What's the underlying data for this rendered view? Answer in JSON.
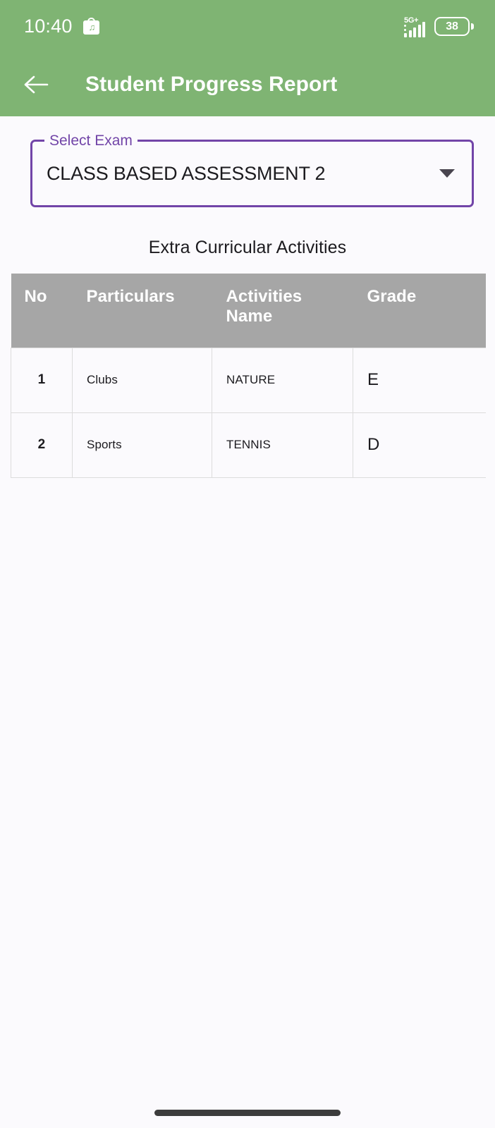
{
  "status_bar": {
    "time": "10:40",
    "notification_icon": "shop-bag-icon",
    "notification_badge": "♫",
    "network_type": "5G+",
    "signal_icon": "signal-bars-icon",
    "battery_level": "38",
    "battery_icon": "battery-icon"
  },
  "app_bar": {
    "back_icon": "arrow-left-icon",
    "title": "Student Progress Report",
    "background_color": "#7FB473"
  },
  "select_exam": {
    "label": "Select Exam",
    "value": "CLASS BASED ASSESSMENT 2",
    "arrow_icon": "chevron-down-icon",
    "accent_color": "#7245A8"
  },
  "section": {
    "title": "Extra Curricular Activities"
  },
  "table": {
    "header_background": "#A6A6A6",
    "columns": [
      "No",
      "Particulars",
      "Activities Name",
      "Grade"
    ],
    "rows": [
      {
        "no": "1",
        "particulars": "Clubs",
        "activity": "NATURE",
        "grade": "E"
      },
      {
        "no": "2",
        "particulars": "Sports",
        "activity": "TENNIS",
        "grade": "D"
      }
    ]
  },
  "navigation": {
    "gesture_pill": "home-gesture-bar"
  }
}
